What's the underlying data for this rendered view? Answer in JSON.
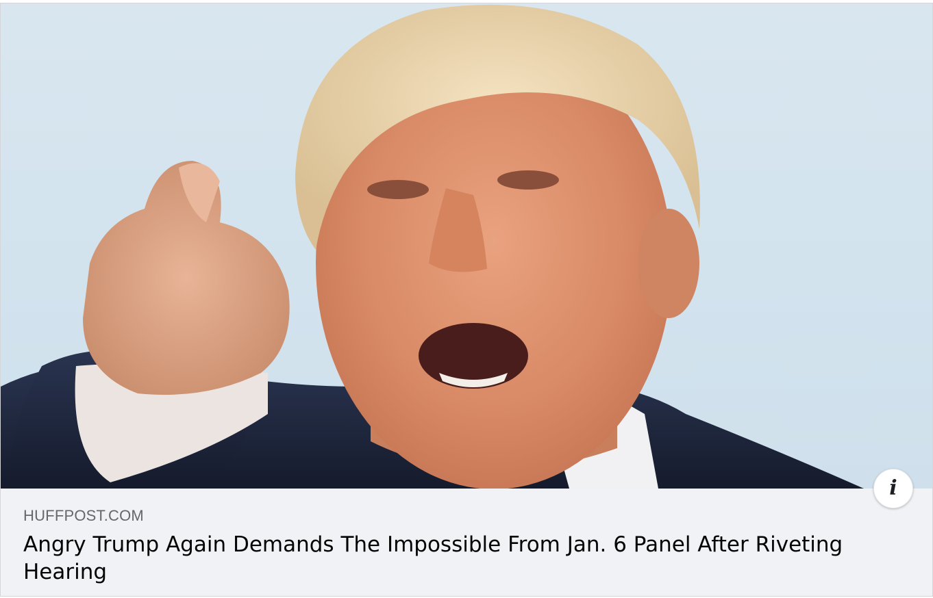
{
  "link_card": {
    "image": {
      "alt_icon": "news-photo",
      "sky_color": "#d2e3ee"
    },
    "info_button": {
      "icon": "info-icon",
      "glyph": "i"
    },
    "source_domain": "HUFFPOST.COM",
    "headline": "Angry Trump Again Demands The Impossible From Jan. 6 Panel After Riveting Hearing"
  }
}
